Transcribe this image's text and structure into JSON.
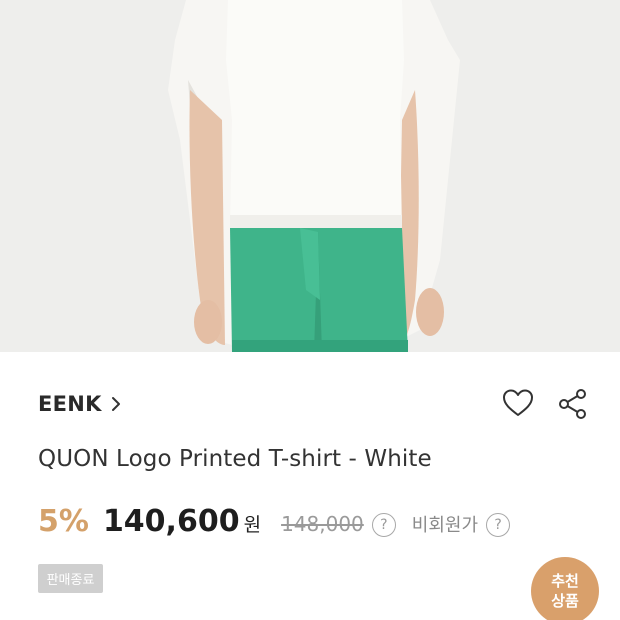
{
  "product_image": {
    "icon": "product-photo"
  },
  "brand": {
    "name": "EENK",
    "icon": "chevron-right-icon"
  },
  "actions": {
    "wishlist_icon": "heart-icon",
    "share_icon": "share-icon"
  },
  "product": {
    "title": "QUON Logo Printed T-shirt - White"
  },
  "price": {
    "discount": "5%",
    "sale_price": "140,600",
    "currency": "원",
    "original_price": "148,000",
    "help_symbol": "?",
    "nonmember_label": "비회원가",
    "accent_color": "#d4a16a"
  },
  "status": {
    "sold_out_label": "판매종료"
  },
  "recommend_button": {
    "line1": "추천",
    "line2": "상품",
    "color": "#d9a06b"
  }
}
